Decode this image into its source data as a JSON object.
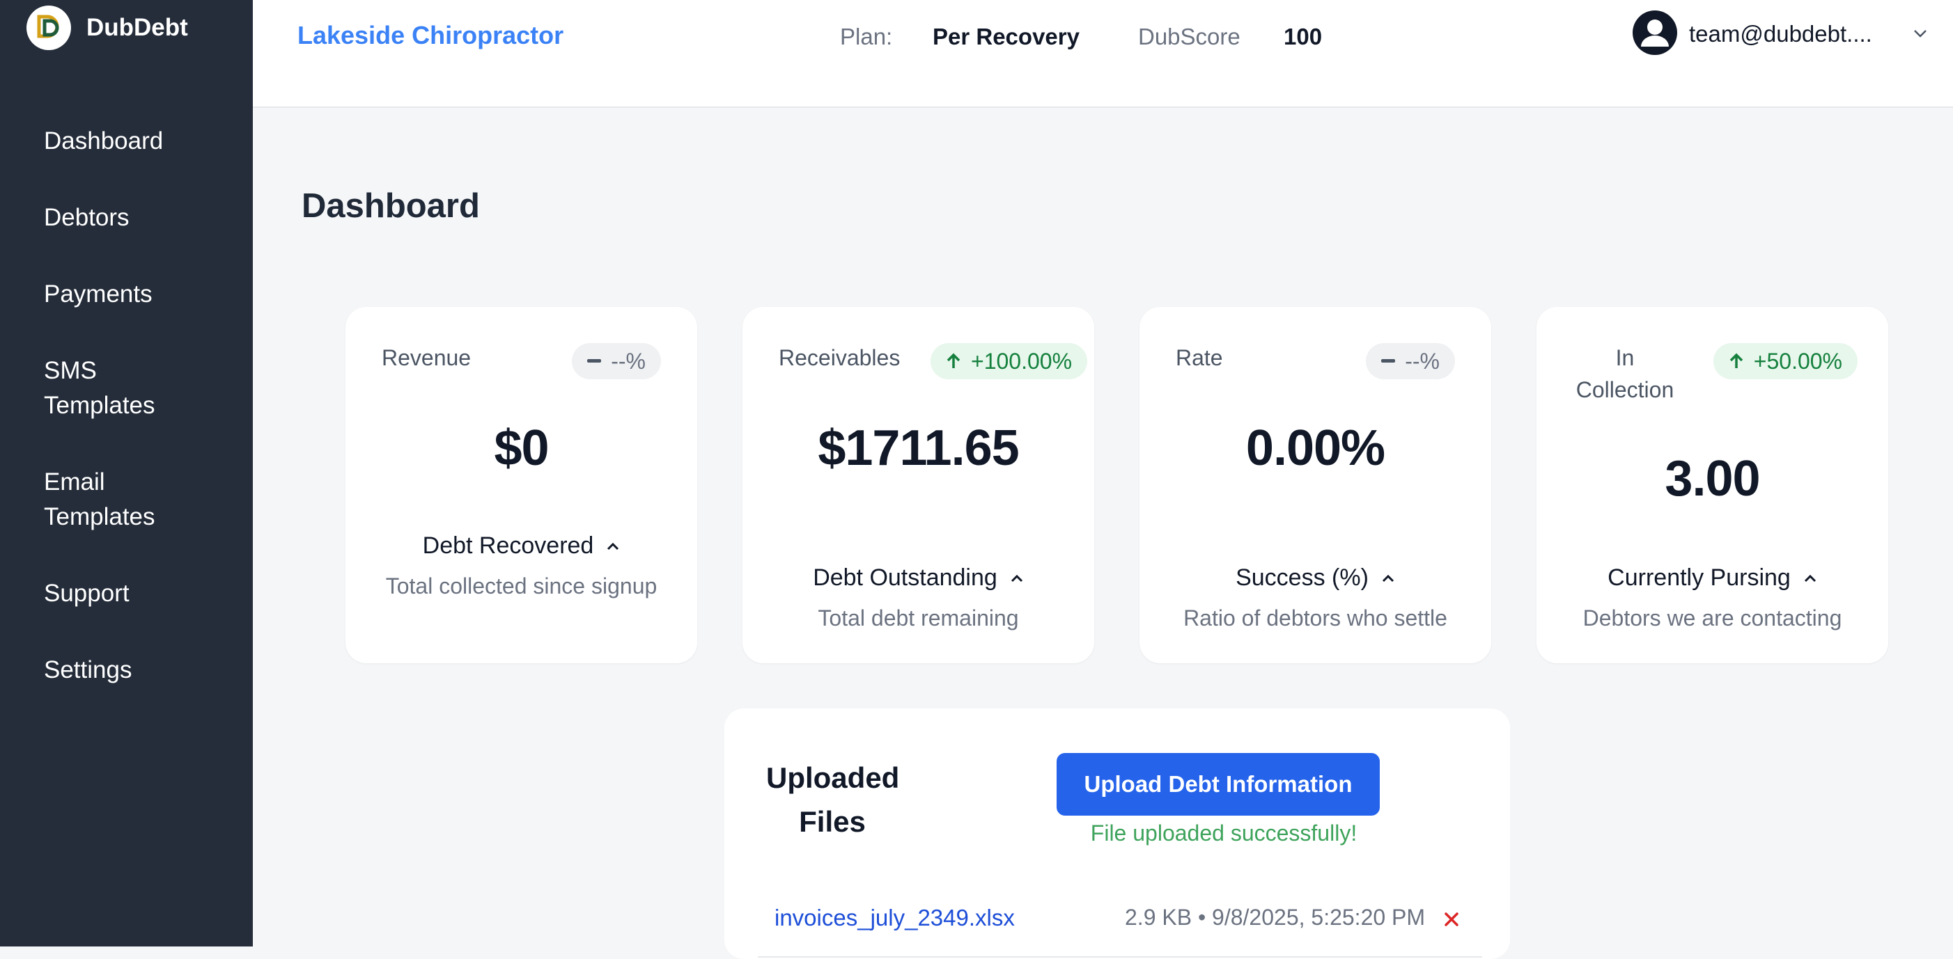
{
  "app": {
    "brand": "DubDebt",
    "logo_letter": "D"
  },
  "sidebar": {
    "items": [
      {
        "label": "Dashboard"
      },
      {
        "label": "Debtors"
      },
      {
        "label": "Payments"
      },
      {
        "label": "SMS\nTemplates"
      },
      {
        "label": "Email\nTemplates"
      },
      {
        "label": "Support"
      },
      {
        "label": "Settings"
      }
    ]
  },
  "header": {
    "org_name": "Lakeside Chiropractor",
    "plan_label": "Plan:",
    "plan_value": "Per Recovery",
    "score_label": "DubScore",
    "score_value": "100",
    "user_email": "team@dubdebt...."
  },
  "page": {
    "title": "Dashboard"
  },
  "cards": [
    {
      "label": "Revenue",
      "badge": "--%",
      "trend": "neutral",
      "value": "$0",
      "footer_title": "Debt Recovered",
      "footer_desc": "Total collected since signup"
    },
    {
      "label": "Receivables",
      "badge": "+100.00%",
      "trend": "up",
      "value": "$1711.65",
      "footer_title": "Debt Outstanding",
      "footer_desc": "Total debt remaining"
    },
    {
      "label": "Rate",
      "badge": "--%",
      "trend": "neutral",
      "value": "0.00%",
      "footer_title": "Success (%)",
      "footer_desc": "Ratio of debtors who settle"
    },
    {
      "label": "In Collection",
      "badge": "+50.00%",
      "trend": "up",
      "value": "3.00",
      "footer_title": "Currently Pursing",
      "footer_desc": "Debtors we are contacting"
    }
  ],
  "uploads": {
    "title": "Uploaded Files",
    "button_label": "Upload Debt Information",
    "status": "File uploaded successfully!",
    "files": [
      {
        "name": "invoices_july_2349.xlsx",
        "meta": "2.9 KB • 9/8/2025, 5:25:20 PM"
      }
    ]
  },
  "colors": {
    "sidebar_bg": "#252d3a",
    "accent": "#2563eb",
    "link": "#3b82f6",
    "success": "#3ea35b",
    "positive_badge_bg": "#e7f7ec",
    "positive_badge_text": "#15803d",
    "danger": "#dc2626"
  },
  "icons": {
    "logo": "dubdebt-logo-icon",
    "avatar": "user-avatar-icon",
    "dropdown": "chevron-down-icon",
    "badge_neutral": "minus-icon",
    "badge_up": "arrow-up-icon",
    "card_toggle": "chevron-up-icon",
    "delete": "close-icon"
  }
}
